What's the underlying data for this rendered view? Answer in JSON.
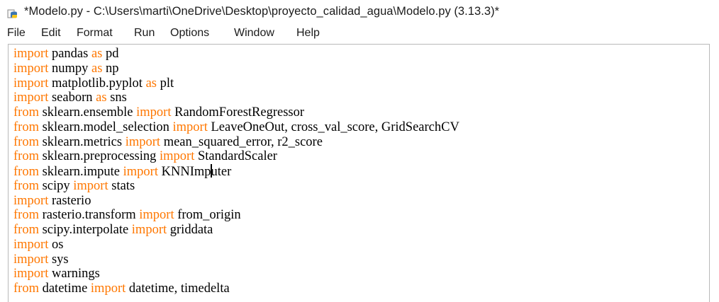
{
  "window": {
    "title": "*Modelo.py - C:\\Users\\marti\\OneDrive\\Desktop\\proyecto_calidad_agua\\Modelo.py (3.13.3)*",
    "icon": "python-file-icon"
  },
  "menu": {
    "items": [
      "File",
      "Edit",
      "Format",
      "Run",
      "Options",
      "Window",
      "Help"
    ]
  },
  "colors": {
    "keyword": "#ff7700",
    "text": "#000000",
    "background": "#ffffff"
  },
  "editor": {
    "lines": [
      [
        {
          "t": "import",
          "kw": true
        },
        {
          "t": " pandas "
        },
        {
          "t": "as",
          "kw": true
        },
        {
          "t": " pd"
        }
      ],
      [
        {
          "t": "import",
          "kw": true
        },
        {
          "t": " numpy "
        },
        {
          "t": "as",
          "kw": true
        },
        {
          "t": " np"
        }
      ],
      [
        {
          "t": "import",
          "kw": true
        },
        {
          "t": " matplotlib.pyplot "
        },
        {
          "t": "as",
          "kw": true
        },
        {
          "t": " plt"
        }
      ],
      [
        {
          "t": "import",
          "kw": true
        },
        {
          "t": " seaborn "
        },
        {
          "t": "as",
          "kw": true
        },
        {
          "t": " sns"
        }
      ],
      [
        {
          "t": "from",
          "kw": true
        },
        {
          "t": " sklearn.ensemble "
        },
        {
          "t": "import",
          "kw": true
        },
        {
          "t": " RandomForestRegressor"
        }
      ],
      [
        {
          "t": "from",
          "kw": true
        },
        {
          "t": " sklearn.model_selection "
        },
        {
          "t": "import",
          "kw": true
        },
        {
          "t": " LeaveOneOut, cross_val_score, GridSearchCV"
        }
      ],
      [
        {
          "t": "from",
          "kw": true
        },
        {
          "t": " sklearn.metrics "
        },
        {
          "t": "import",
          "kw": true
        },
        {
          "t": " mean_squared_error, r2_score"
        }
      ],
      [
        {
          "t": "from",
          "kw": true
        },
        {
          "t": " sklearn.preprocessing "
        },
        {
          "t": "import",
          "kw": true
        },
        {
          "t": " StandardScaler"
        }
      ],
      [
        {
          "t": "from",
          "kw": true
        },
        {
          "t": " sklearn.impute "
        },
        {
          "t": "import",
          "kw": true
        },
        {
          "t": " KNNImp"
        },
        {
          "caret": true
        },
        {
          "t": "uter"
        }
      ],
      [
        {
          "t": "from",
          "kw": true
        },
        {
          "t": " scipy "
        },
        {
          "t": "import",
          "kw": true
        },
        {
          "t": " stats"
        }
      ],
      [
        {
          "t": "import",
          "kw": true
        },
        {
          "t": " rasterio"
        }
      ],
      [
        {
          "t": "from",
          "kw": true
        },
        {
          "t": " rasterio.transform "
        },
        {
          "t": "import",
          "kw": true
        },
        {
          "t": " from_origin"
        }
      ],
      [
        {
          "t": "from",
          "kw": true
        },
        {
          "t": " scipy.interpolate "
        },
        {
          "t": "import",
          "kw": true
        },
        {
          "t": " griddata"
        }
      ],
      [
        {
          "t": "import",
          "kw": true
        },
        {
          "t": " os"
        }
      ],
      [
        {
          "t": "import",
          "kw": true
        },
        {
          "t": " sys"
        }
      ],
      [
        {
          "t": "import",
          "kw": true
        },
        {
          "t": " warnings"
        }
      ],
      [
        {
          "t": "from",
          "kw": true
        },
        {
          "t": " datetime "
        },
        {
          "t": "import",
          "kw": true
        },
        {
          "t": " datetime, timedelta"
        }
      ]
    ]
  }
}
